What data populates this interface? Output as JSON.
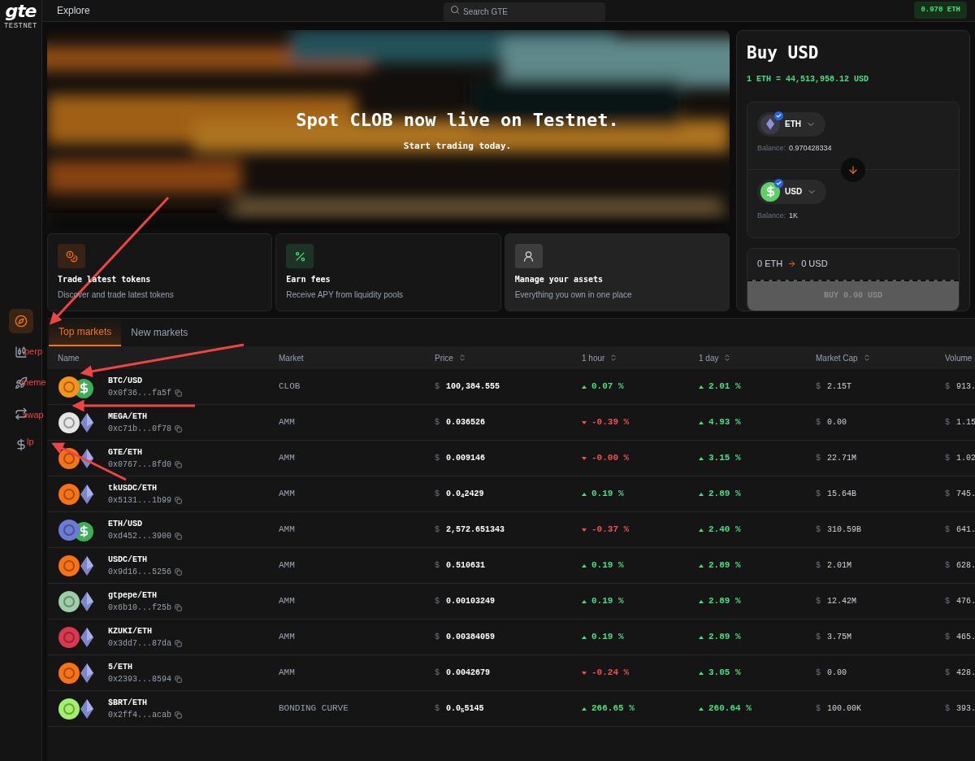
{
  "brand": {
    "logo": "gte",
    "network": "TESTNET"
  },
  "top_bar": {
    "title": "Explore",
    "search": {
      "placeholder": "Search GTE"
    },
    "balance": "0.970 ETH"
  },
  "sidebar": {
    "items": [
      {
        "kind": "compass",
        "selected": true
      },
      {
        "kind": "perp",
        "selected": false
      },
      {
        "kind": "meme",
        "selected": false
      },
      {
        "kind": "swap",
        "selected": false
      },
      {
        "kind": "lp",
        "selected": false
      }
    ]
  },
  "hero": {
    "kind": "picture",
    "title": "Spot CLOB now live on Testnet.",
    "subtitle": "Start trading today."
  },
  "features": [
    {
      "kind": "coins",
      "color": "#f97316",
      "title": "Trade latest tokens",
      "description": "Discover and trade latest tokens"
    },
    {
      "kind": "percent",
      "color": "#4ade80",
      "title": "Earn fees",
      "description": "Receive APY from liquidity pools"
    },
    {
      "kind": "user",
      "color": "#d4d4d4",
      "title": "Manage your assets",
      "description": "Everything you own in one place"
    }
  ],
  "buy_panel": {
    "title": "Buy USD",
    "rate": "1 ETH = 44,513,958.12 USD",
    "legs": [
      {
        "kind": "eth",
        "token": "ETH",
        "balance_label": "Balance:",
        "balance": "0.970428334"
      },
      {
        "kind": "dollar",
        "token": "USD",
        "balance_label": "Balance:",
        "balance": "1K"
      }
    ],
    "summary": {
      "from": "0 ETH",
      "to": "0 USD"
    },
    "button": {
      "label": "BUY 0.00 USD",
      "disabled": true
    }
  },
  "tabs": [
    {
      "label": "Top markets",
      "selected": true
    },
    {
      "label": "New markets",
      "selected": false
    }
  ],
  "table": {
    "columns": [
      {
        "label": "Name",
        "sortable": false
      },
      {
        "label": "Market",
        "sortable": false
      },
      {
        "label": "Price",
        "sortable": true
      },
      {
        "label": "1 hour",
        "sortable": true
      },
      {
        "label": "1 day",
        "sortable": true
      },
      {
        "label": "Market Cap",
        "sortable": true
      },
      {
        "label": "Volume",
        "sortable": false
      }
    ],
    "rows": [
      {
        "base_icon": {
          "color": "#f7931a"
        },
        "quote_icon": {
          "kind": "dollar"
        },
        "pair": "BTC/USD",
        "address": "0x0f36...fa5f",
        "market": "CLOB",
        "price_sign": "$",
        "price": "100,384.555",
        "hour": {
          "text": "0.07 %",
          "kind": "up"
        },
        "day": {
          "text": "2.01 %",
          "kind": "up"
        },
        "cap_sign": "$",
        "cap": "2.15T",
        "volume_sign": "$",
        "volume": "913."
      },
      {
        "base_icon": {
          "color": "#e5e5e5"
        },
        "quote_icon": {
          "kind": "eth"
        },
        "pair": "MEGA/ETH",
        "address": "0xc71b...0f78",
        "market": "AMM",
        "price_sign": "$",
        "price": "0.036526",
        "hour": {
          "text": "-0.39 %",
          "kind": "down"
        },
        "day": {
          "text": "4.93 %",
          "kind": "up"
        },
        "cap_sign": "$",
        "cap": "0.00",
        "volume_sign": "$",
        "volume": "1.15"
      },
      {
        "base_icon": {
          "color": "#f97316"
        },
        "quote_icon": {
          "kind": "eth"
        },
        "pair": "GTE/ETH",
        "address": "0x0767...8fd0",
        "market": "AMM",
        "price_sign": "$",
        "price": "0.009146",
        "hour": {
          "text": "-0.00 %",
          "kind": "down"
        },
        "day": {
          "text": "3.15 %",
          "kind": "up"
        },
        "cap_sign": "$",
        "cap": "22.71M",
        "volume_sign": "$",
        "volume": "1.02"
      },
      {
        "base_icon": {
          "color": "#f97316"
        },
        "quote_icon": {
          "kind": "eth"
        },
        "pair": "tkUSDC/ETH",
        "address": "0x5131...1b99",
        "market": "AMM",
        "price_sign": "$",
        "price": "0.0$_{4}$2429",
        "hour": {
          "text": "0.19 %",
          "kind": "up"
        },
        "day": {
          "text": "2.89 %",
          "kind": "up"
        },
        "cap_sign": "$",
        "cap": "15.64B",
        "volume_sign": "$",
        "volume": "745."
      },
      {
        "base_icon": {
          "color": "#6b7bd6"
        },
        "quote_icon": {
          "kind": "dollar"
        },
        "pair": "ETH/USD",
        "address": "0xd452...3900",
        "market": "AMM",
        "price_sign": "$",
        "price": "2,572.651343",
        "hour": {
          "text": "-0.37 %",
          "kind": "down"
        },
        "day": {
          "text": "2.40 %",
          "kind": "up"
        },
        "cap_sign": "$",
        "cap": "310.59B",
        "volume_sign": "$",
        "volume": "641."
      },
      {
        "base_icon": {
          "color": "#f97316"
        },
        "quote_icon": {
          "kind": "eth"
        },
        "pair": "USDC/ETH",
        "address": "0x9d16...5256",
        "market": "AMM",
        "price_sign": "$",
        "price": "0.510631",
        "hour": {
          "text": "0.19 %",
          "kind": "up"
        },
        "day": {
          "text": "2.89 %",
          "kind": "up"
        },
        "cap_sign": "$",
        "cap": "2.01M",
        "volume_sign": "$",
        "volume": "628."
      },
      {
        "base_icon": {
          "color": "#9ccfa8"
        },
        "quote_icon": {
          "kind": "eth"
        },
        "pair": "gtpepe/ETH",
        "address": "0x6b10...f25b",
        "market": "AMM",
        "price_sign": "$",
        "price": "0.00103249",
        "hour": {
          "text": "0.19 %",
          "kind": "up"
        },
        "day": {
          "text": "2.89 %",
          "kind": "up"
        },
        "cap_sign": "$",
        "cap": "12.42M",
        "volume_sign": "$",
        "volume": "476."
      },
      {
        "base_icon": {
          "color": "#d9384f"
        },
        "quote_icon": {
          "kind": "eth"
        },
        "pair": "KZUKI/ETH",
        "address": "0x3dd7...87da",
        "market": "AMM",
        "price_sign": "$",
        "price": "0.00384059",
        "hour": {
          "text": "0.19 %",
          "kind": "up"
        },
        "day": {
          "text": "2.89 %",
          "kind": "up"
        },
        "cap_sign": "$",
        "cap": "3.75M",
        "volume_sign": "$",
        "volume": "465."
      },
      {
        "base_icon": {
          "color": "#f97316"
        },
        "quote_icon": {
          "kind": "eth"
        },
        "pair": "5/ETH",
        "address": "0x2393...8594",
        "market": "AMM",
        "price_sign": "$",
        "price": "0.0042679",
        "hour": {
          "text": "-0.24 %",
          "kind": "down"
        },
        "day": {
          "text": "3.05 %",
          "kind": "up"
        },
        "cap_sign": "$",
        "cap": "0.00",
        "volume_sign": "$",
        "volume": "428."
      },
      {
        "base_icon": {
          "color": "#a3f06b"
        },
        "quote_icon": {
          "kind": "eth"
        },
        "pair": "$BRT/ETH",
        "address": "0x2ff4...acab",
        "market": "BONDING CURVE",
        "price_sign": "$",
        "price": "0.0$_{5}$5145",
        "hour": {
          "text": "266.65 %",
          "kind": "up"
        },
        "day": {
          "text": "260.64 %",
          "kind": "up"
        },
        "cap_sign": "$",
        "cap": "100.00K",
        "volume_sign": "$",
        "volume": "393."
      }
    ]
  },
  "annotations": [
    {
      "label": "perp"
    },
    {
      "label": "meme"
    },
    {
      "label": "swap"
    },
    {
      "label": "lp"
    }
  ]
}
